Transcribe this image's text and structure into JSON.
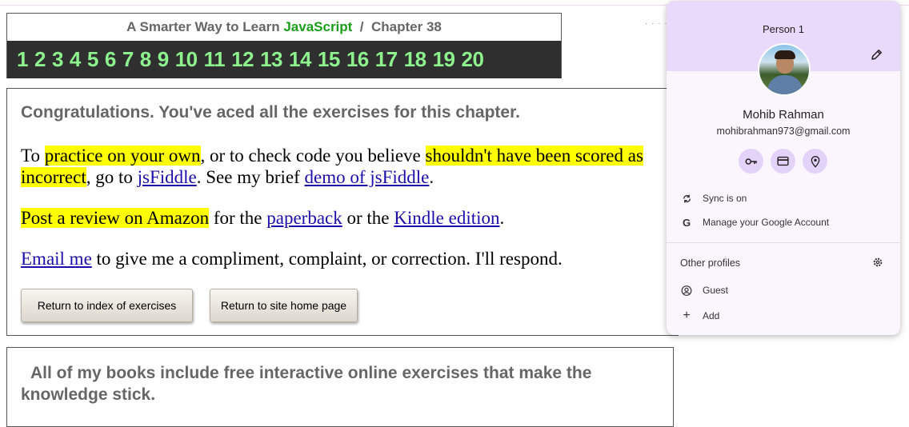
{
  "chapter_header": {
    "prefix": "A Smarter Way to Learn",
    "brand": "JavaScript",
    "separator": "/",
    "chapter": "Chapter 38",
    "exercise_numbers": [
      "1",
      "2",
      "3",
      "4",
      "5",
      "6",
      "7",
      "8",
      "9",
      "10",
      "11",
      "12",
      "13",
      "14",
      "15",
      "16",
      "17",
      "18",
      "19",
      "20"
    ]
  },
  "dots": "· · · ·",
  "congrats": {
    "heading": "Congratulations. You've aced all the exercises for this chapter.",
    "p1": {
      "t1": "To ",
      "hl1": "practice on your own",
      "t2": ", or to check code you believe ",
      "hl2": "shouldn't have been scored as incorrect",
      "t3": ", go to ",
      "link1": "jsFiddle",
      "t4": ". See my brief ",
      "link2": "demo of jsFiddle",
      "t5": "."
    },
    "p2": {
      "hl": "Post a review on Amazon",
      "t1": " for the ",
      "link1": "paperback",
      "t2": " or the ",
      "link2": "Kindle edition",
      "t3": "."
    },
    "p3": {
      "link": "Email me",
      "t1": " to give me a compliment, complaint, or correction. I'll respond."
    },
    "btn_index": "Return to index of exercises",
    "btn_home": "Return to site home page"
  },
  "books": {
    "text": "All of my books include free interactive online exercises that make the knowledge stick."
  },
  "profile": {
    "profile_label": "Person 1",
    "full_name": "Mohib Rahman",
    "email": "mohibrahman973@gmail.com",
    "sync": "Sync is on",
    "manage": "Manage your Google Account",
    "other_profiles": "Other profiles",
    "guest": "Guest",
    "add": "Add",
    "icons": [
      "key-icon",
      "credit-card-icon",
      "location-pin-icon"
    ]
  },
  "colors": {
    "highlight": "#ffff00",
    "link": "#1a0dab",
    "number_bar_bg": "#2f2f2f",
    "number_color": "#8df28d",
    "brand_green": "#1a9e1a",
    "profile_header": "#e9d9fb"
  }
}
